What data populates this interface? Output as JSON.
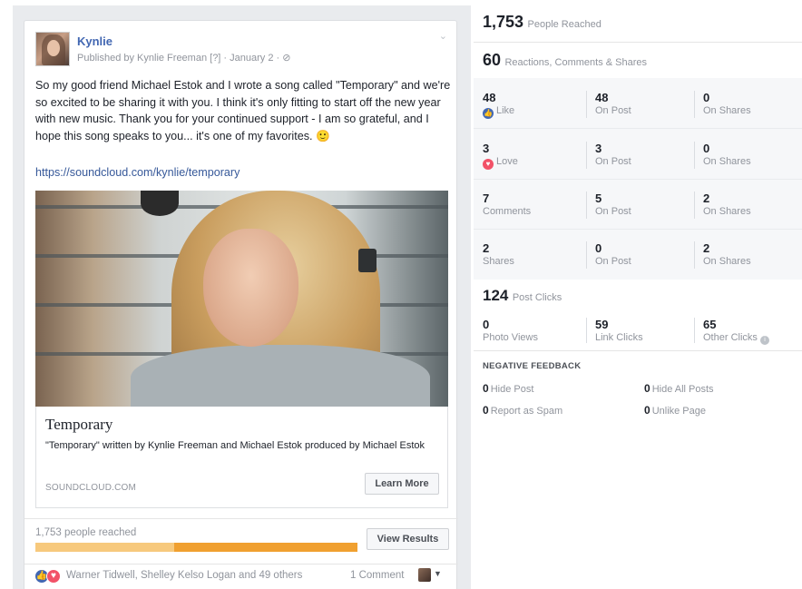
{
  "post": {
    "author": "Kynlie",
    "meta": "Published by Kynlie Freeman [?] · January 2 · ⊘",
    "body": "So my good friend Michael Estok and I wrote a song called \"Temporary\" and we're so excited to be sharing it with you. I think it's only fitting to start off the new year with new music. Thank you for your continued support - I am so grateful, and I hope this song speaks to you... it's one of my favorites. 🙂",
    "link": "https://soundcloud.com/kynlie/temporary",
    "card": {
      "title": "Temporary",
      "description": "\"Temporary\" written by Kynlie Freeman and Michael Estok produced by Michael Estok",
      "domain": "SOUNDCLOUD.COM",
      "button": "Learn More"
    },
    "poll": {
      "reached": "1,753 people reached",
      "button": "View Results",
      "progress_fraction": 0.43
    },
    "footer": {
      "reactors": "Warner Tidwell, Shelley Kelso Logan and 49 others",
      "comments": "1 Comment"
    }
  },
  "insights": {
    "reached": {
      "value": "1,753",
      "label": "People Reached"
    },
    "engagement": {
      "value": "60",
      "label": "Reactions, Comments & Shares"
    },
    "rows": [
      {
        "cells": [
          {
            "value": "48",
            "label": "Like",
            "icon": "like-icon"
          },
          {
            "value": "48",
            "label": "On Post"
          },
          {
            "value": "0",
            "label": "On Shares"
          }
        ]
      },
      {
        "cells": [
          {
            "value": "3",
            "label": "Love",
            "icon": "love-icon"
          },
          {
            "value": "3",
            "label": "On Post"
          },
          {
            "value": "0",
            "label": "On Shares"
          }
        ]
      },
      {
        "cells": [
          {
            "value": "7",
            "label": "Comments"
          },
          {
            "value": "5",
            "label": "On Post"
          },
          {
            "value": "2",
            "label": "On Shares"
          }
        ]
      },
      {
        "cells": [
          {
            "value": "2",
            "label": "Shares"
          },
          {
            "value": "0",
            "label": "On Post"
          },
          {
            "value": "2",
            "label": "On Shares"
          }
        ]
      }
    ],
    "clicks": {
      "value": "124",
      "label": "Post Clicks",
      "cells": [
        {
          "value": "0",
          "label": "Photo Views"
        },
        {
          "value": "59",
          "label": "Link Clicks"
        },
        {
          "value": "65",
          "label": "Other Clicks"
        }
      ]
    },
    "negative": {
      "title": "NEGATIVE FEEDBACK",
      "items": [
        {
          "value": "0",
          "label": "Hide Post"
        },
        {
          "value": "0",
          "label": "Hide All Posts"
        },
        {
          "value": "0",
          "label": "Report as Spam"
        },
        {
          "value": "0",
          "label": "Unlike Page"
        }
      ]
    }
  },
  "colors": {
    "brand_blue": "#4267b2",
    "link_blue": "#365899",
    "love_red": "#f25268",
    "poll_bar": "#f0a030"
  }
}
